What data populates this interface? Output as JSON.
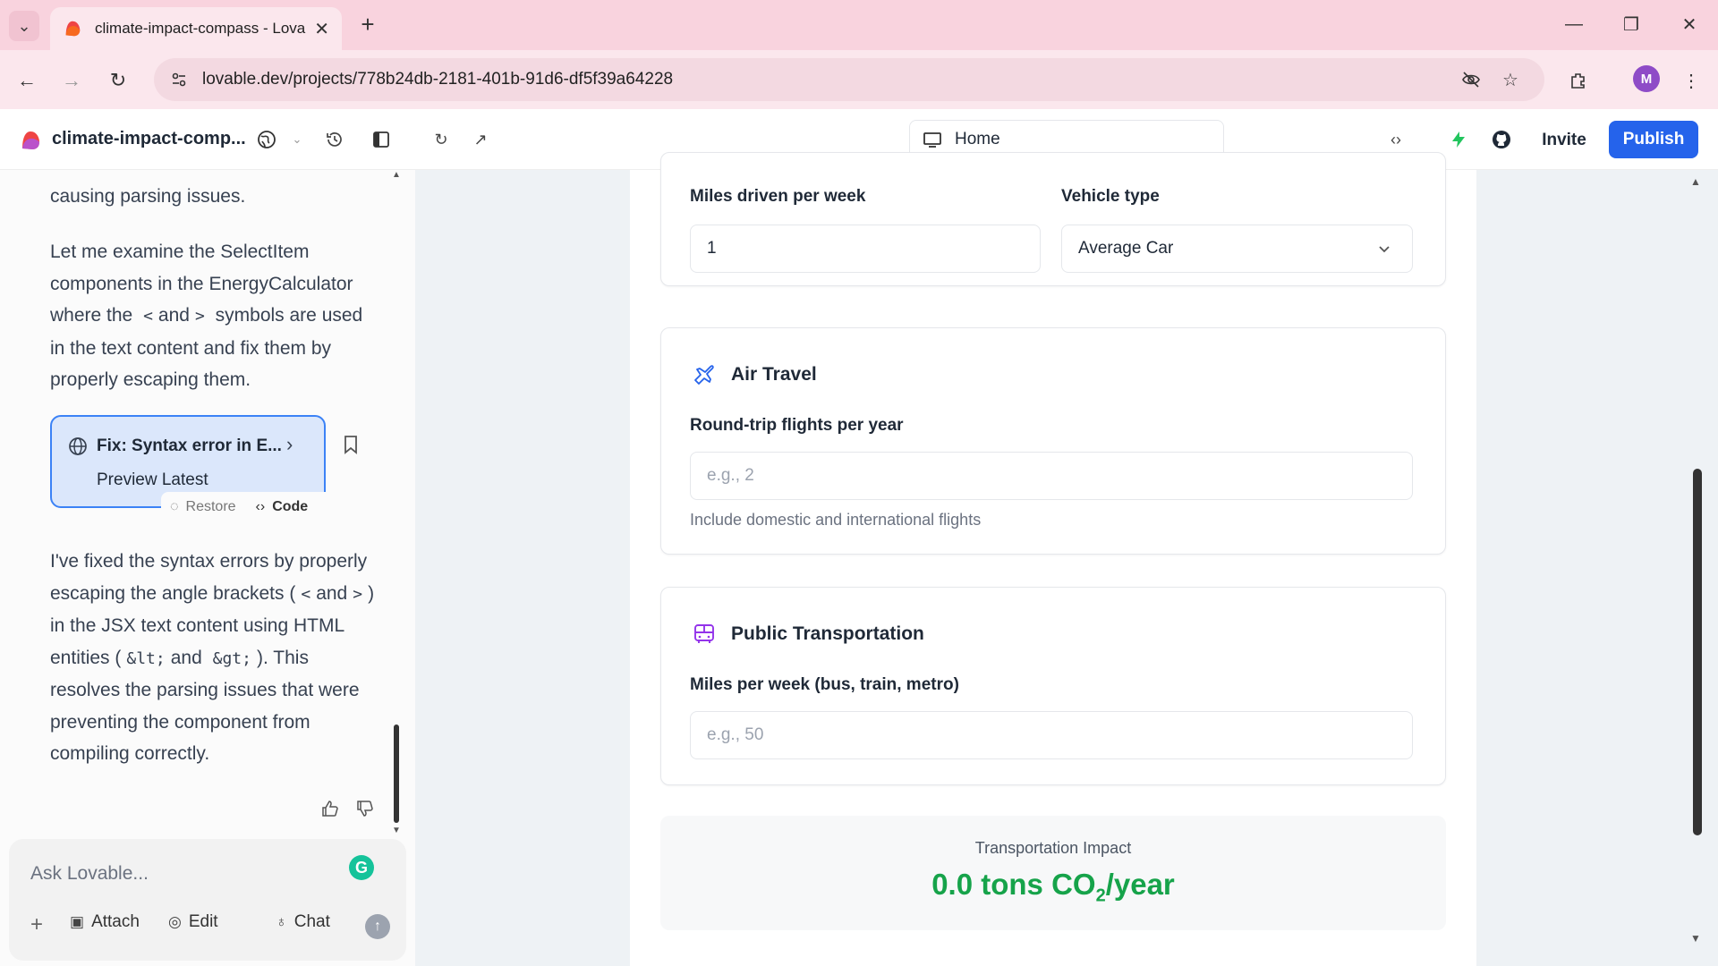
{
  "browser": {
    "tab_title": "climate-impact-compass - Lova",
    "url": "lovable.dev/projects/778b24db-2181-401b-91d6-df5f39a64228",
    "profile_initial": "M"
  },
  "app": {
    "project_name": "climate-impact-comp...",
    "route": "Home",
    "invite_label": "Invite",
    "publish_label": "Publish",
    "accent_color": "#2563eb"
  },
  "chat": {
    "partial_line": "causing parsing issues.",
    "para1": "Let me examine the SelectItem components in the EnergyCalculator where the",
    "lt": "<",
    "and1": "and",
    "gt": ">",
    "para1_end": "symbols are used in the text content and fix them by properly escaping them.",
    "fix_card": {
      "title": "Fix: Syntax error in E...",
      "subtitle": "Preview Latest",
      "restore_label": "Restore",
      "code_label": "Code"
    },
    "para2_a": "I've fixed the syntax errors by properly escaping the angle brackets (",
    "para2_lt": "<",
    "para2_and": "and",
    "para2_gt": ">",
    "para2_b": ") in the JSX text content using HTML entities (",
    "para2_ent1": "&lt;",
    "para2_and2": "and",
    "para2_ent2": "&gt;",
    "para2_c": "). This resolves the parsing issues that were preventing the component from compiling correctly.",
    "composer": {
      "placeholder": "Ask Lovable...",
      "attach_label": "Attach",
      "edit_label": "Edit",
      "chat_label": "Chat"
    }
  },
  "form": {
    "car": {
      "miles_label": "Miles driven per week",
      "miles_value": "1",
      "vehicle_label": "Vehicle type",
      "vehicle_value": "Average Car"
    },
    "air": {
      "title": "Air Travel",
      "flights_label": "Round-trip flights per year",
      "flights_placeholder": "e.g., 2",
      "help": "Include domestic and international flights",
      "icon_color": "#2563eb"
    },
    "public": {
      "title": "Public Transportation",
      "miles_label": "Miles per week (bus, train, metro)",
      "miles_placeholder": "e.g., 50",
      "icon_color": "#9333ea"
    },
    "impact": {
      "label": "Transportation Impact",
      "value": "0.0 tons CO",
      "sub": "2",
      "unit": "/year",
      "color": "#16a34a"
    }
  }
}
